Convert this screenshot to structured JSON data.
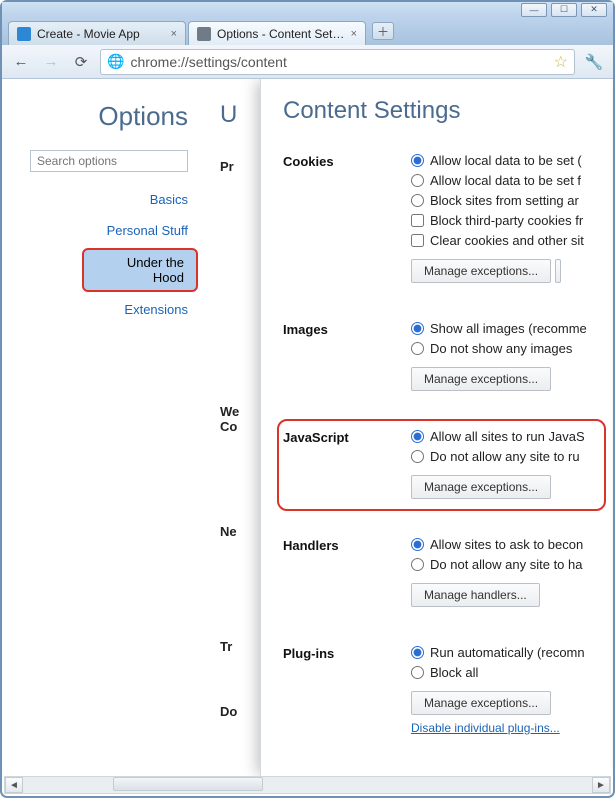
{
  "window": {
    "min_icon": "—",
    "max_icon": "☐",
    "close_icon": "✕"
  },
  "tabs": [
    {
      "title": "Create - Movie App",
      "active": false,
      "favicon_color": "#2c87d4"
    },
    {
      "title": "Options - Content Settings",
      "active": true,
      "favicon_color": "#6f7c88"
    }
  ],
  "new_tab_icon": "＋",
  "toolbar": {
    "back": "←",
    "forward": "→",
    "reload": "⟳",
    "globe": "🌐",
    "url": "chrome://settings/content",
    "star": "☆",
    "wrench": "🔧"
  },
  "sidebar": {
    "heading": "Options",
    "search_placeholder": "Search options",
    "links": {
      "basics": "Basics",
      "personal": "Personal Stuff",
      "under_hood": "Under the Hood",
      "extensions": "Extensions"
    }
  },
  "underlay": {
    "heading_clip": "U",
    "labels": {
      "privacy": "Pr",
      "web": "We",
      "co": "Co",
      "ne": "Ne",
      "tr": "Tr",
      "do": "Do"
    }
  },
  "overlay": {
    "heading": "Content Settings",
    "sections": {
      "cookies": {
        "title": "Cookies",
        "options": [
          {
            "type": "radio",
            "checked": true,
            "label": "Allow local data to be set ("
          },
          {
            "type": "radio",
            "checked": false,
            "label": "Allow local data to be set f"
          },
          {
            "type": "radio",
            "checked": false,
            "label": "Block sites from setting ar"
          },
          {
            "type": "checkbox",
            "checked": false,
            "label": "Block third-party cookies fr"
          },
          {
            "type": "checkbox",
            "checked": false,
            "label": "Clear cookies and other sit"
          }
        ],
        "button": "Manage exceptions...",
        "extra_button_stub": true
      },
      "images": {
        "title": "Images",
        "options": [
          {
            "type": "radio",
            "checked": true,
            "label": "Show all images (recomme"
          },
          {
            "type": "radio",
            "checked": false,
            "label": "Do not show any images"
          }
        ],
        "button": "Manage exceptions..."
      },
      "javascript": {
        "title": "JavaScript",
        "options": [
          {
            "type": "radio",
            "checked": true,
            "label": "Allow all sites to run JavaS"
          },
          {
            "type": "radio",
            "checked": false,
            "label": "Do not allow any site to ru"
          }
        ],
        "button": "Manage exceptions...",
        "highlighted": true
      },
      "handlers": {
        "title": "Handlers",
        "options": [
          {
            "type": "radio",
            "checked": true,
            "label": "Allow sites to ask to becon"
          },
          {
            "type": "radio",
            "checked": false,
            "label": "Do not allow any site to ha"
          }
        ],
        "button": "Manage handlers..."
      },
      "plugins": {
        "title": "Plug-ins",
        "options": [
          {
            "type": "radio",
            "checked": true,
            "label": "Run automatically (recomn"
          },
          {
            "type": "radio",
            "checked": false,
            "label": "Block all"
          }
        ],
        "button": "Manage exceptions...",
        "link": "Disable individual plug-ins..."
      }
    }
  },
  "hscroll": {
    "left": "◄",
    "right": "►"
  }
}
